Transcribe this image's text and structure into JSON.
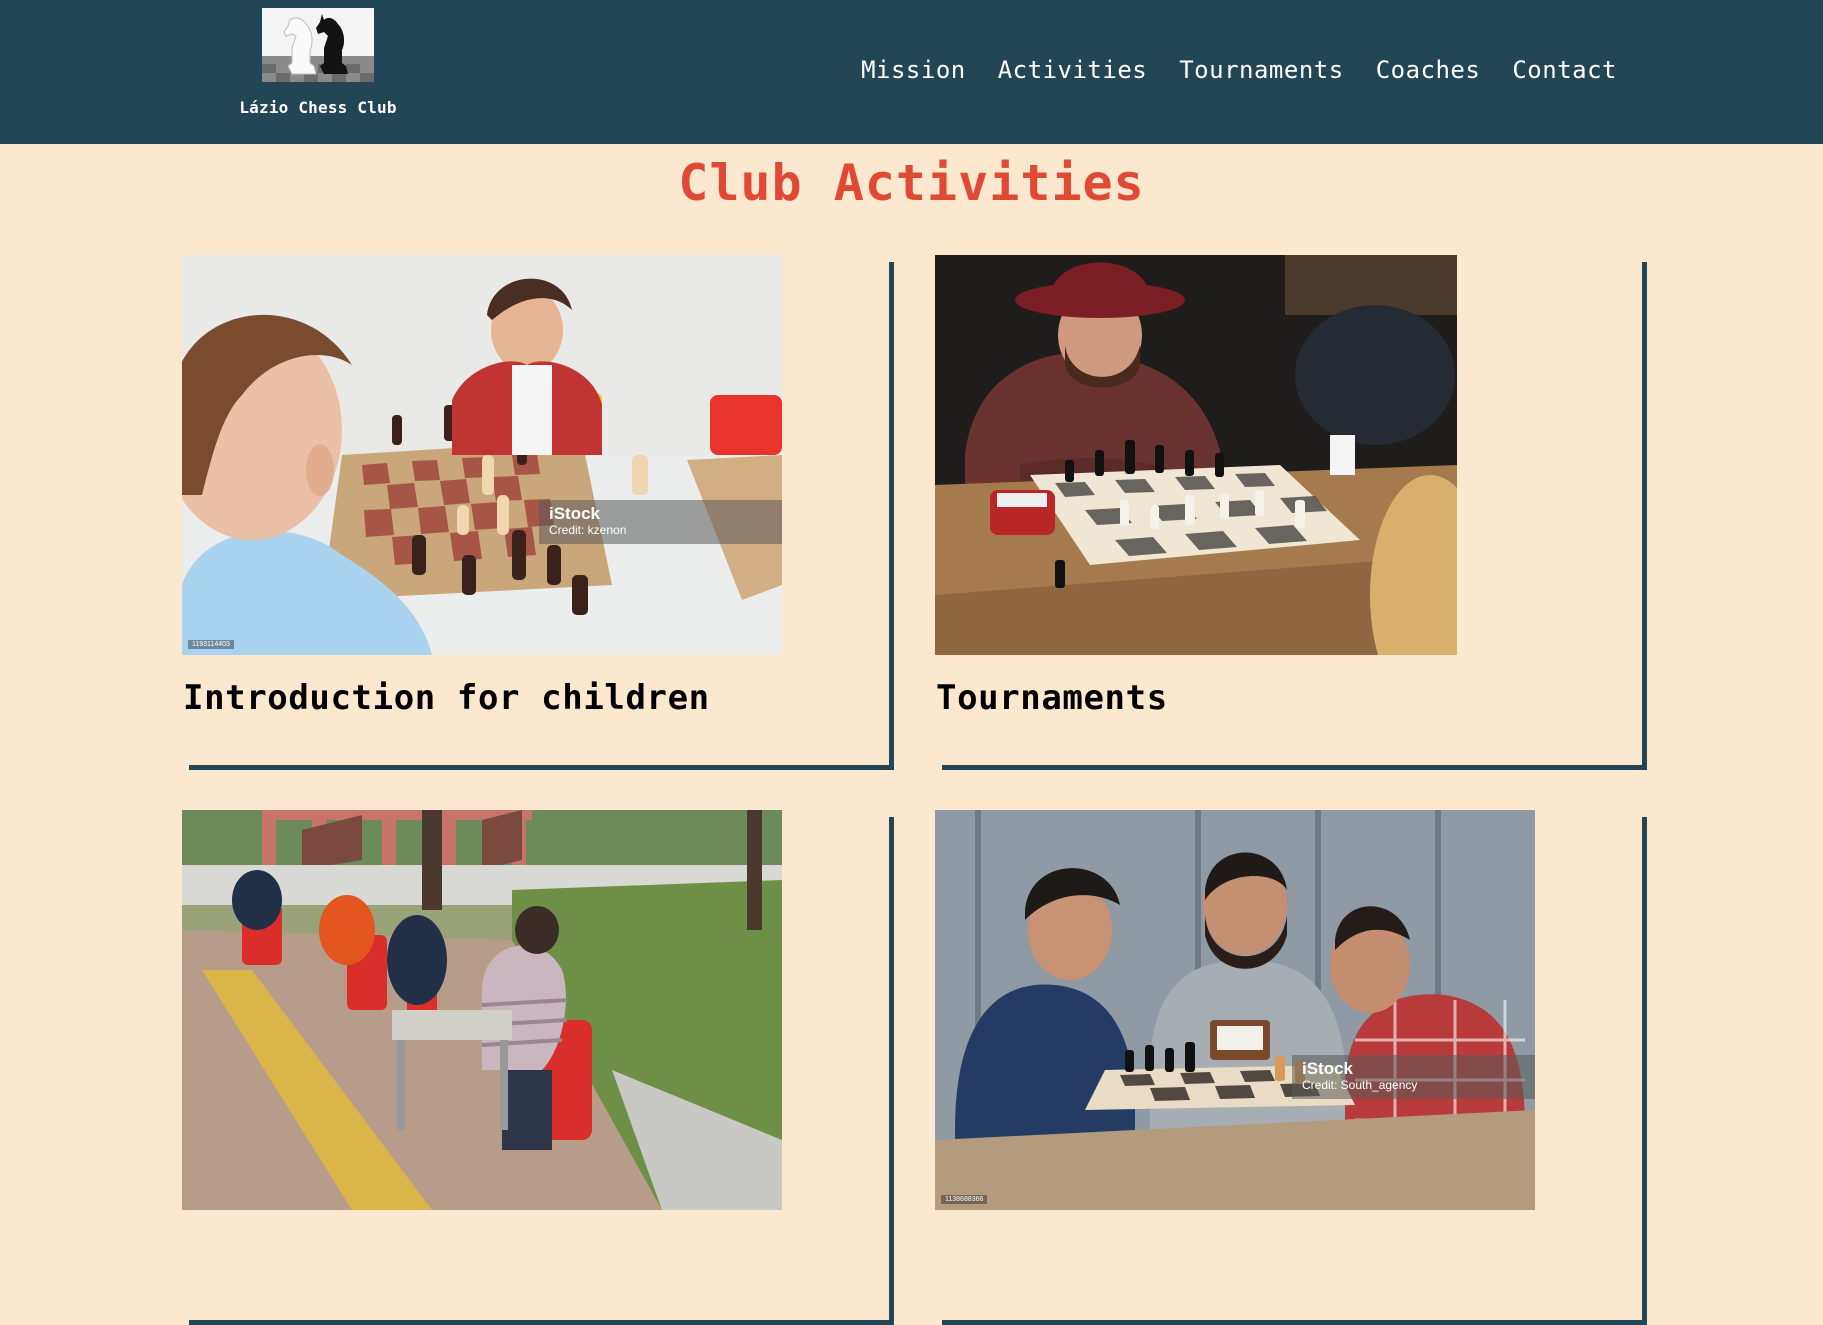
{
  "site": {
    "name": "Lázio Chess Club"
  },
  "nav": {
    "items": [
      "Mission",
      "Activities",
      "Tournaments",
      "Coaches",
      "Contact"
    ]
  },
  "page": {
    "title": "Club Activities"
  },
  "activities": [
    {
      "title": "Introduction for children",
      "watermark_brand": "iStock",
      "watermark_credit": "Credit: kzenon",
      "stock_id": "1193114403"
    },
    {
      "title": "Tournaments"
    },
    {
      "title": ""
    },
    {
      "title": "",
      "watermark_brand": "iStock",
      "watermark_credit": "Credit: South_agency",
      "stock_id": "1138688366"
    }
  ],
  "colors": {
    "header_bg": "#224655",
    "page_bg": "#fbe8cf",
    "title": "#e04a35",
    "frame": "#224655"
  }
}
